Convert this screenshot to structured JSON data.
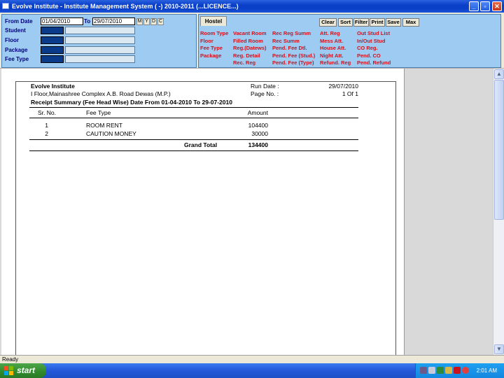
{
  "window": {
    "title": "Evolve Institute - Institute Management System ( -) 2010-2011 (...LICENCE...)"
  },
  "filter": {
    "from_label": "From Date",
    "from_value": "01/04/2010",
    "to_label": "To",
    "to_value": "29/07/2010",
    "period_buttons": [
      "M",
      "Y",
      "D",
      "C"
    ],
    "fields": [
      "Student",
      "Floor",
      "Package",
      "Fee Type"
    ]
  },
  "toolbar": {
    "tab": "Hostel",
    "buttons": [
      "Clear",
      "Sort",
      "Filter",
      "Print",
      "Save",
      "Max"
    ]
  },
  "reports": {
    "col1": [
      "Room Type",
      "Floor",
      "Fee Type",
      "Package"
    ],
    "col2": [
      "Vacant Room",
      "Filled Room",
      "Reg.(Datews)",
      "Reg. Detail",
      "Rec. Reg"
    ],
    "col3": [
      "Rec Reg Summ",
      "Rec Summ",
      "Pend. Fee Dtl.",
      "Pend. Fee (Stud.)",
      "Pend. Fee (Type)"
    ],
    "col4": [
      "Att. Reg",
      "Mess Att.",
      "House Att.",
      "Night Att.",
      "Refund. Reg"
    ],
    "col5": [
      "Out Stud List",
      "In/Out Stud",
      "CO Reg.",
      "Pend. CO",
      "Pend. Refund"
    ]
  },
  "report": {
    "institute": "Evolve Institute",
    "address": "I Floor,Mainashree Complex A.B. Road Dewas (M.P.)",
    "run_date_label": "Run Date :",
    "run_date": "29/07/2010",
    "page_label": "Page No. :",
    "page_value": "1 Of 1",
    "title": "Receipt Summary (Fee Head Wise) Date From 01-04-2010 To 29-07-2010",
    "columns": [
      "Sr. No.",
      "Fee Type",
      "Amount"
    ],
    "rows": [
      {
        "sr": "1",
        "fee_type": "ROOM RENT",
        "amount": "104400"
      },
      {
        "sr": "2",
        "fee_type": "CAUTION MONEY",
        "amount": "30000"
      }
    ],
    "total_label": "Grand Total",
    "total_value": "134400"
  },
  "status": {
    "text": "Ready"
  },
  "taskbar": {
    "start_label": "start",
    "clock": "2:01 AM"
  }
}
